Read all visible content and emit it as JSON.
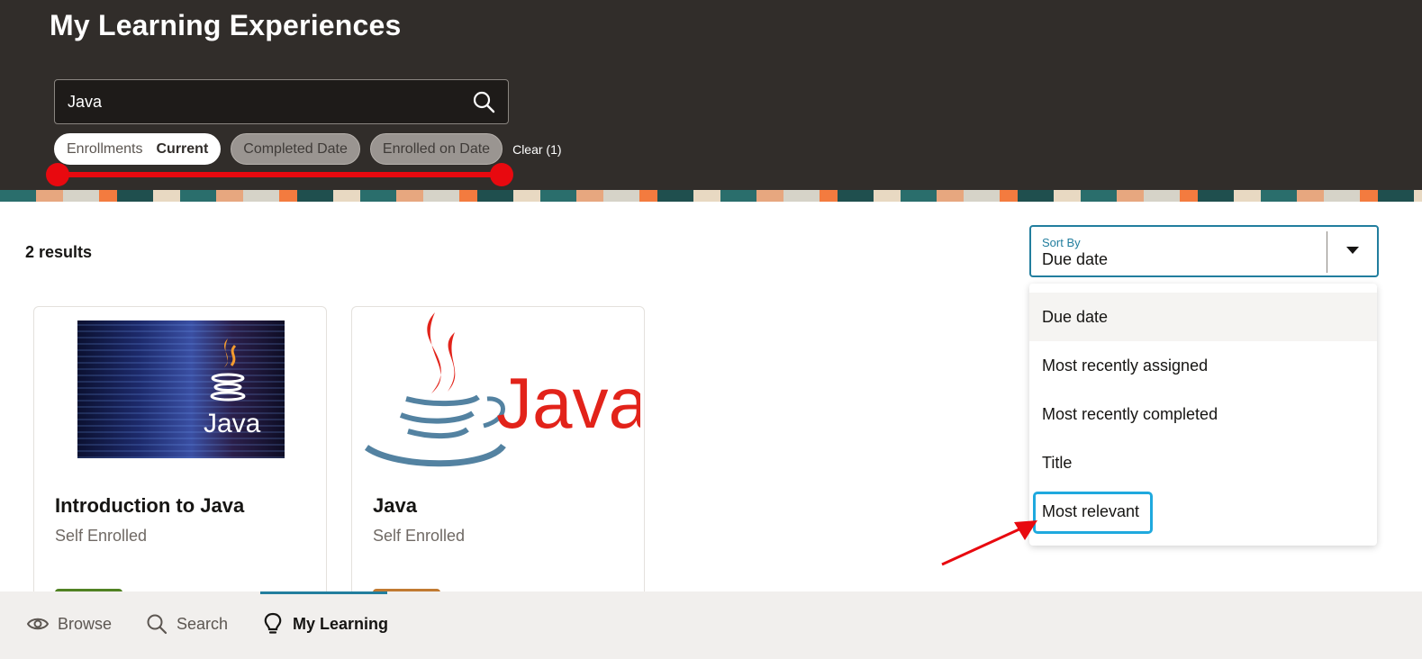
{
  "header": {
    "title": "My Learning Experiences",
    "search": {
      "value": "Java",
      "icon": "search-icon"
    },
    "filters": [
      {
        "label": "Enrollments",
        "value": "Current",
        "active": true
      },
      {
        "label": "Completed Date",
        "active": false
      },
      {
        "label": "Enrolled on Date",
        "active": false
      }
    ],
    "clear_label": "Clear (1)"
  },
  "main": {
    "results_count": "2 results",
    "sort": {
      "label": "Sort By",
      "value": "Due date",
      "options": [
        "Due date",
        "Most recently assigned",
        "Most recently completed",
        "Title",
        "Most relevant"
      ]
    },
    "cards": [
      {
        "title": "Introduction to Java",
        "subtitle": "Self Enrolled",
        "thumb_text": "Java",
        "pill_color": "#508223"
      },
      {
        "title": "Java",
        "subtitle": "Self Enrolled",
        "thumb_text": "Java",
        "pill_color": "#c17a32"
      }
    ]
  },
  "bottom_nav": {
    "items": [
      {
        "label": "Browse",
        "icon": "eye-icon"
      },
      {
        "label": "Search",
        "icon": "search-icon"
      },
      {
        "label": "My Learning",
        "icon": "lightbulb-icon",
        "active": true
      }
    ]
  },
  "colors": {
    "header_bg": "#312d2a",
    "accent": "#227e9e",
    "annotation_red": "#e8090f",
    "highlight_blue": "#1fa9de"
  }
}
